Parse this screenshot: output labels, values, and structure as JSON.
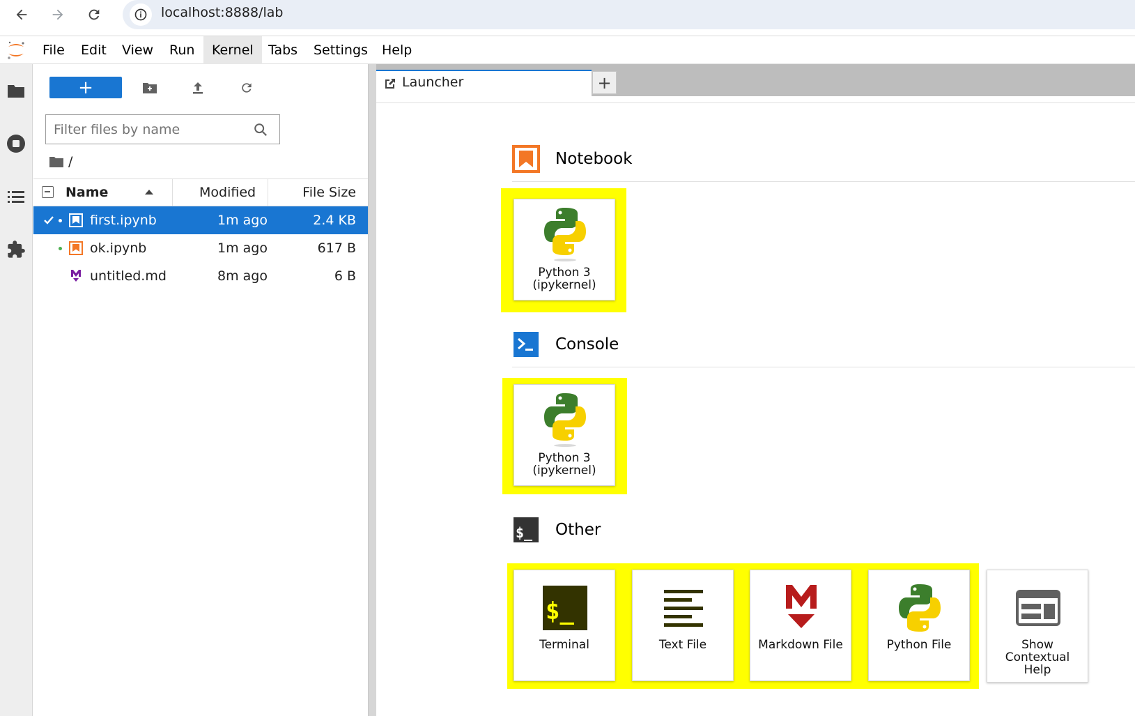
{
  "browser": {
    "url": "localhost:8888/lab"
  },
  "menu": {
    "items": [
      "File",
      "Edit",
      "View",
      "Run",
      "Kernel",
      "Tabs",
      "Settings",
      "Help"
    ],
    "active": "Kernel"
  },
  "filebrowser": {
    "new_label": "+",
    "filter_placeholder": "Filter files by name",
    "breadcrumb": "/",
    "columns": {
      "name": "Name",
      "modified": "Modified",
      "size": "File Size"
    },
    "files": [
      {
        "name": "first.ipynb",
        "modified": "1m ago",
        "size": "2.4 KB",
        "type": "notebook",
        "selected": true,
        "running": true
      },
      {
        "name": "ok.ipynb",
        "modified": "1m ago",
        "size": "617 B",
        "type": "notebook",
        "selected": false,
        "running": true
      },
      {
        "name": "untitled.md",
        "modified": "8m ago",
        "size": "6 B",
        "type": "markdown",
        "selected": false,
        "running": false
      }
    ]
  },
  "tabs": {
    "active_label": "Launcher",
    "add_label": "+"
  },
  "launcher": {
    "notebook": {
      "title": "Notebook",
      "cards": [
        {
          "line1": "Python 3",
          "line2": "(ipykernel)"
        }
      ]
    },
    "console": {
      "title": "Console",
      "cards": [
        {
          "line1": "Python 3",
          "line2": "(ipykernel)"
        }
      ]
    },
    "other": {
      "title": "Other",
      "cards": [
        {
          "label": "Terminal",
          "icon": "terminal-icon"
        },
        {
          "label": "Text File",
          "icon": "text-file-icon"
        },
        {
          "label": "Markdown File",
          "icon": "markdown-icon"
        },
        {
          "label": "Python File",
          "icon": "python-icon"
        },
        {
          "line1": "Show",
          "line2": "Contextual",
          "line3": "Help",
          "icon": "contextual-help-icon"
        }
      ]
    }
  },
  "colors": {
    "accent": "#1976d2",
    "highlight": "#ffff00",
    "notebook_orange": "#f37726",
    "markdown_red": "#b71c1c"
  }
}
